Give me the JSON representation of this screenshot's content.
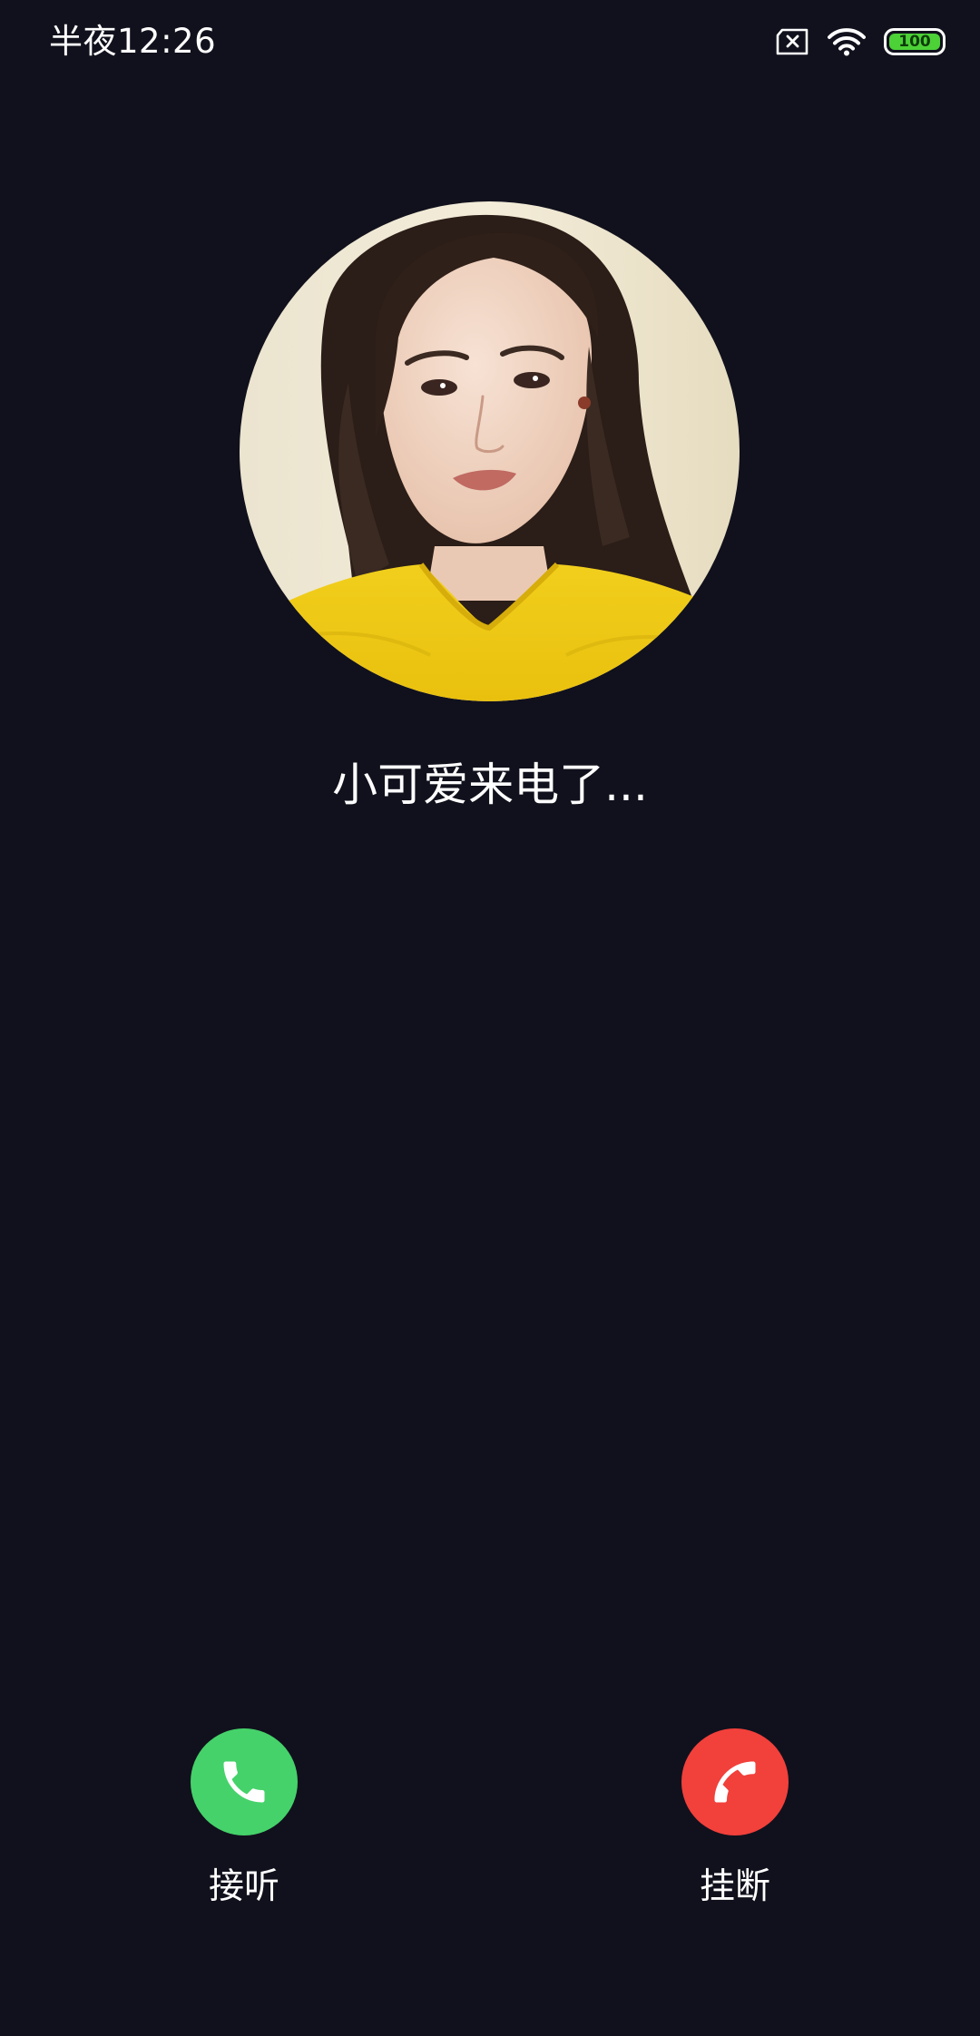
{
  "status_bar": {
    "time": "半夜12:26",
    "battery_level": "100",
    "icons": [
      "no-sim-icon",
      "wifi-icon",
      "battery-icon"
    ]
  },
  "caller": {
    "avatar_icon": "caller-avatar-photo",
    "status_text": "小可爱来电了..."
  },
  "actions": {
    "answer": {
      "label": "接听",
      "icon": "phone-answer-icon",
      "color": "#45d26a"
    },
    "hangup": {
      "label": "挂断",
      "icon": "phone-hangup-icon",
      "color": "#f2403b"
    }
  },
  "colors": {
    "background": "#11111d",
    "battery_fill": "#4cd137"
  }
}
